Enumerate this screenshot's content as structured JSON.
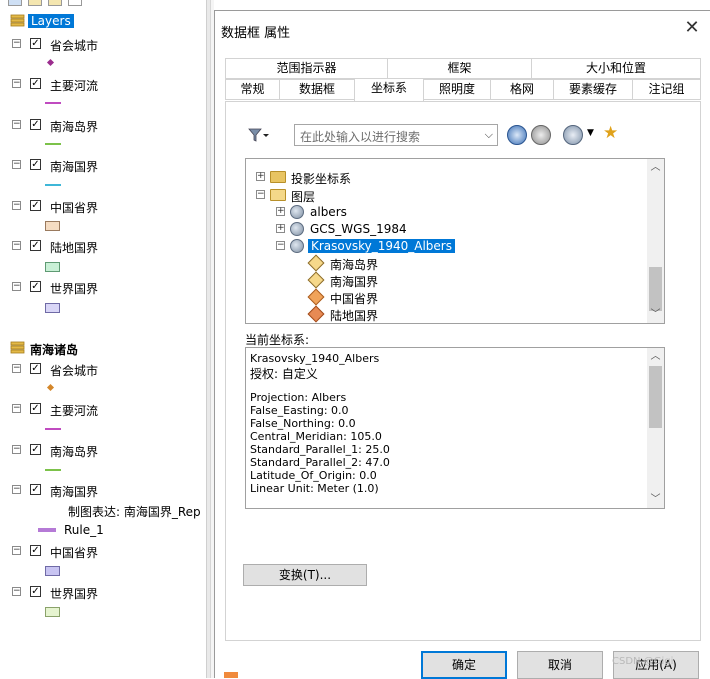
{
  "toc": {
    "root_label": "Layers",
    "group1": {
      "layers": [
        {
          "label": "省会城市",
          "symbol": "point",
          "color": "#9b2d8e"
        },
        {
          "label": "主要河流",
          "symbol": "line",
          "color": "#c04bc0"
        },
        {
          "label": "南海岛界",
          "symbol": "line",
          "color": "#7cc24a"
        },
        {
          "label": "南海国界",
          "symbol": "line",
          "color": "#3fb7d8"
        },
        {
          "label": "中国省界",
          "symbol": "polygon",
          "color": "#f5dcc2"
        },
        {
          "label": "陆地国界",
          "symbol": "polygon",
          "color": "#c9f0d6"
        },
        {
          "label": "世界国界",
          "symbol": "polygon",
          "color": "#d9d6f7"
        }
      ]
    },
    "group2": {
      "label": "南海诸岛",
      "layers": [
        {
          "label": "省会城市",
          "symbol": "point",
          "color": "#d4862a"
        },
        {
          "label": "主要河流",
          "symbol": "line",
          "color": "#c04bc0"
        },
        {
          "label": "南海岛界",
          "symbol": "line",
          "color": "#7cc24a"
        },
        {
          "label": "南海国界",
          "symbol": "none",
          "color": "#000000"
        },
        {
          "label": "中国省界",
          "symbol": "polygon",
          "color": "#c8c4f2"
        },
        {
          "label": "世界国界",
          "symbol": "polygon",
          "color": "#e6f4d0"
        }
      ],
      "representation_label": "制图表达: 南海国界_Rep",
      "rule_label": "Rule_1"
    }
  },
  "dialog": {
    "title": "数据框 属性",
    "close_glyph": "✕",
    "tabs_row1": [
      "范围指示器",
      "框架",
      "大小和位置"
    ],
    "tabs_row2": [
      "常规",
      "数据框",
      "坐标系",
      "照明度",
      "格网",
      "要素缓存",
      "注记组"
    ],
    "active_tab": "坐标系",
    "search_placeholder": "在此处输入以进行搜索",
    "tree": {
      "projected": "投影坐标系",
      "layers_folder": "图层",
      "albers": "albers",
      "gcs": "GCS_WGS_1984",
      "krasovsky": "Krasovsky_1940_Albers",
      "sublayers": [
        "南海岛界",
        "南海国界",
        "中国省界",
        "陆地国界"
      ]
    },
    "current_cs_label": "当前坐标系:",
    "current_cs_lines": [
      "Krasovsky_1940_Albers",
      "授权: 自定义",
      "",
      "Projection: Albers",
      "False_Easting: 0.0",
      "False_Northing: 0.0",
      "Central_Meridian: 105.0",
      "Standard_Parallel_1: 25.0",
      "Standard_Parallel_2: 47.0",
      "Latitude_Of_Origin: 0.0",
      "Linear Unit: Meter (1.0)"
    ],
    "transform_button": "变换(T)...",
    "ok_button": "确定",
    "cancel_button": "取消",
    "apply_button": "应用(A)"
  },
  "watermark": "CSDN @Gigi",
  "colors": {
    "selection": "#0078d7",
    "folder": "#e8c462",
    "group_icon": "#e3b948"
  }
}
